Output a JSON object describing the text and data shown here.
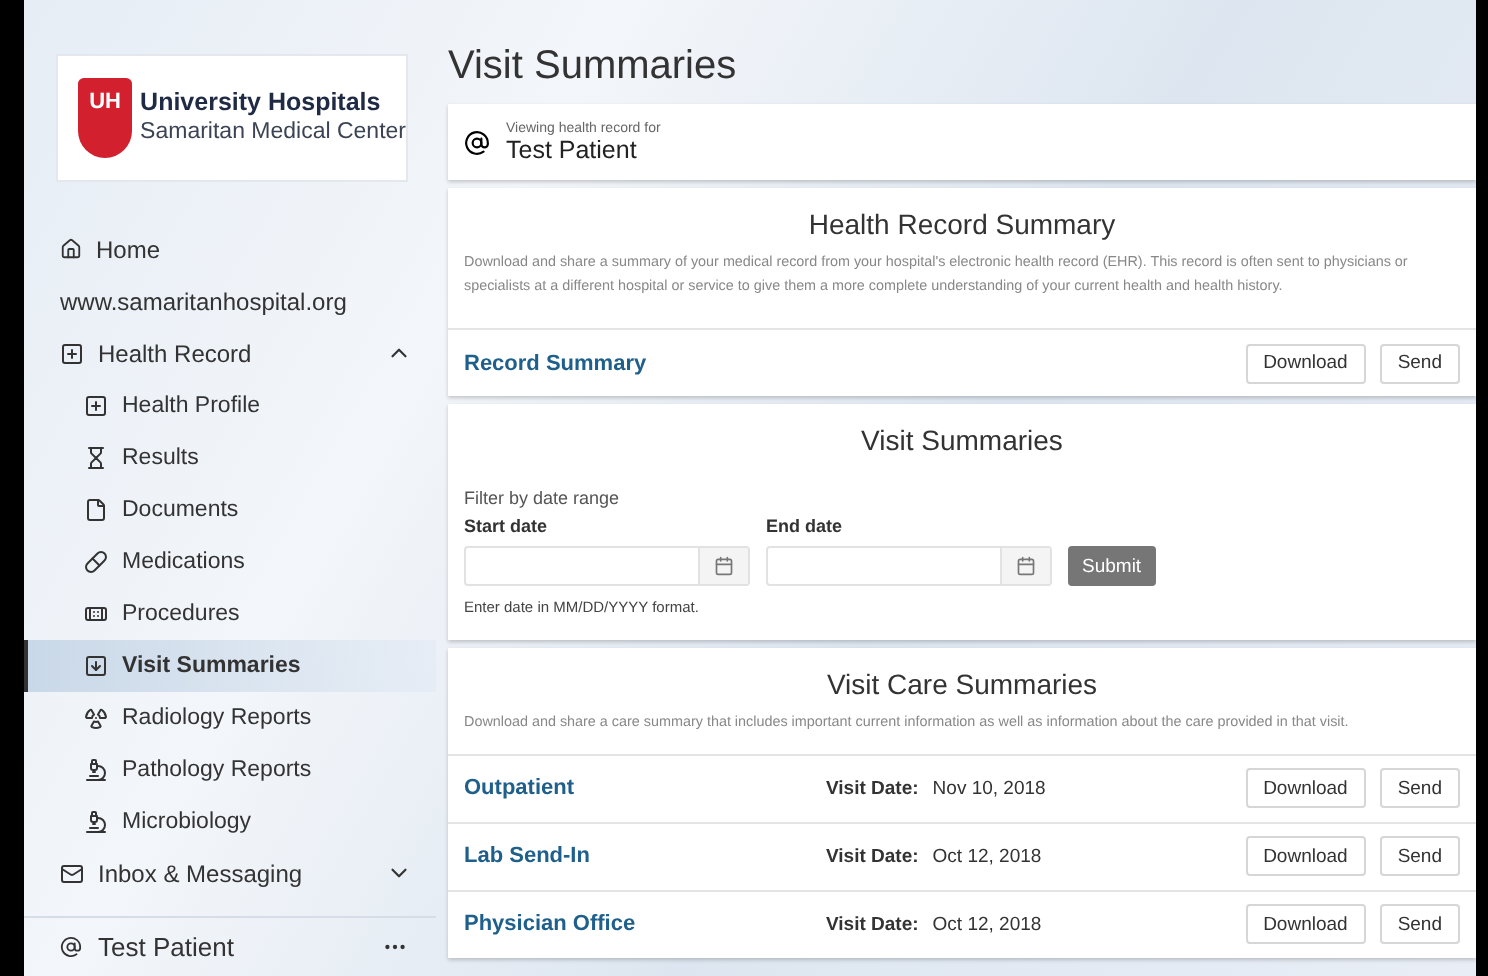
{
  "logo": {
    "mark": "UH",
    "name": "University Hospitals",
    "subtitle": "Samaritan Medical Center"
  },
  "nav": [
    {
      "kind": "link",
      "label": "Home",
      "selected": false
    },
    {
      "kind": "text",
      "label": "www.samaritanhospital.org"
    },
    {
      "kind": "group",
      "label": "Health Record",
      "expanded": true,
      "children": [
        {
          "label": "Health Profile",
          "selected": false
        },
        {
          "label": "Results",
          "selected": false
        },
        {
          "label": "Documents",
          "selected": false
        },
        {
          "label": "Medications",
          "selected": false
        },
        {
          "label": "Procedures",
          "selected": false
        },
        {
          "label": "Visit Summaries",
          "selected": true
        },
        {
          "label": "Radiology Reports",
          "selected": false
        },
        {
          "label": "Pathology Reports",
          "selected": false
        },
        {
          "label": "Microbiology",
          "selected": false
        }
      ]
    },
    {
      "kind": "group",
      "label": "Inbox & Messaging",
      "expanded": false
    }
  ],
  "user": {
    "name": "Test Patient"
  },
  "page_title": "Visit Summaries",
  "patient": {
    "caption": "Viewing health record for",
    "name": "Test Patient"
  },
  "record_card": {
    "title": "Health Record Summary",
    "description": "Download and share a summary of your medical record from your hospital's electronic health record (EHR). This record is often sent to physicians or specialists at a different hospital or service to give them a more complete understanding of your current health and health history.",
    "item": "Record Summary",
    "buttons": [
      "Download",
      "Send"
    ]
  },
  "filter_card": {
    "title": "Visit Summaries",
    "caption": "Filter by date range",
    "fields": [
      {
        "label": "Start date"
      },
      {
        "label": "End date"
      }
    ],
    "submit": "Submit",
    "hint": "Enter date in MM/DD/YYYY format."
  },
  "care_card": {
    "title": "Visit Care Summaries",
    "description": "Download and share a care summary that includes important current information as well as information about the care provided in that visit.",
    "rows": [
      {
        "name": "Outpatient",
        "date_label": "Visit Date:",
        "date": "Nov 10, 2018",
        "buttons": [
          "Download",
          "Send"
        ]
      },
      {
        "name": "Lab Send-In",
        "date_label": "Visit Date:",
        "date": "Oct 12, 2018",
        "buttons": [
          "Download",
          "Send"
        ]
      },
      {
        "name": "Physician Office",
        "date_label": "Visit Date:",
        "date": "Oct 12, 2018",
        "buttons": [
          "Download",
          "Send"
        ]
      }
    ]
  }
}
